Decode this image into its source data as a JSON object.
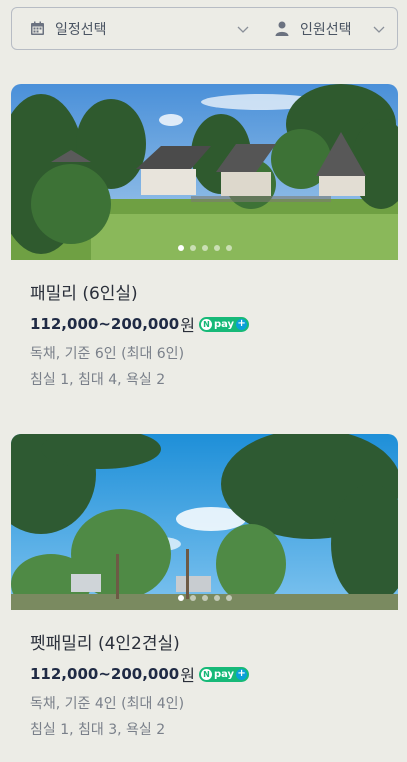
{
  "filters": {
    "date_label": "일정선택",
    "people_label": "인원선택"
  },
  "rooms": [
    {
      "name": "패밀리 (6인실)",
      "price": "112,000~200,000",
      "currency": "원",
      "pay_badge": "pay",
      "pay_badge_n": "N",
      "pay_badge_plus": "+",
      "detail1": "독채, 기준 6인 (최대 6인)",
      "detail2": "침실 1, 침대 4, 욕실 2",
      "carousel_count": 5,
      "carousel_active": 1
    },
    {
      "name": "펫패밀리 (4인2견실)",
      "price": "112,000~200,000",
      "currency": "원",
      "pay_badge": "pay",
      "pay_badge_n": "N",
      "pay_badge_plus": "+",
      "detail1": "독채, 기준 4인 (최대 4인)",
      "detail2": "침실 1, 침대 3, 욕실 2",
      "carousel_count": 5,
      "carousel_active": 1
    }
  ],
  "colors": {
    "background": "#ecece6",
    "npay_green": "#17b978",
    "price_text": "#1f2a44"
  }
}
